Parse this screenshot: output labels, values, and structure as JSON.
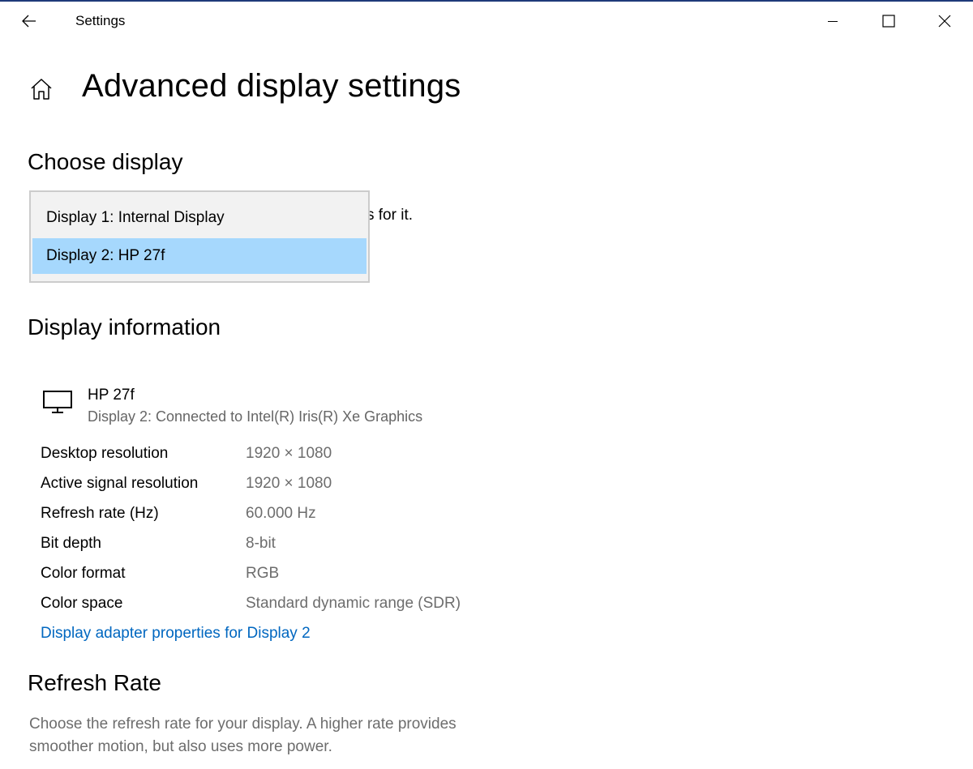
{
  "window": {
    "app_title": "Settings",
    "icons": {
      "back": "arrow-left-icon",
      "minimize": "minimize-icon",
      "maximize": "maximize-icon",
      "close": "close-icon",
      "home": "home-icon",
      "monitor": "monitor-icon"
    }
  },
  "page": {
    "title": "Advanced display settings"
  },
  "choose_display": {
    "heading": "Choose display",
    "description_visible_fragment": "s for it.",
    "options": [
      {
        "label": "Display 1: Internal Display",
        "selected": false
      },
      {
        "label": "Display 2: HP 27f",
        "selected": true
      }
    ]
  },
  "display_information": {
    "heading": "Display information",
    "monitor_name": "HP 27f",
    "monitor_subtitle": "Display 2: Connected to Intel(R) Iris(R) Xe Graphics",
    "rows": [
      {
        "label": "Desktop resolution",
        "value": "1920 × 1080"
      },
      {
        "label": "Active signal resolution",
        "value": "1920 × 1080"
      },
      {
        "label": "Refresh rate (Hz)",
        "value": "60.000 Hz"
      },
      {
        "label": "Bit depth",
        "value": "8-bit"
      },
      {
        "label": "Color format",
        "value": "RGB"
      },
      {
        "label": "Color space",
        "value": "Standard dynamic range (SDR)"
      }
    ],
    "adapter_link": "Display adapter properties for Display 2"
  },
  "refresh_rate": {
    "heading": "Refresh Rate",
    "description_line1": "Choose the refresh rate for your display. A higher rate provides",
    "description_line2": "smoother motion, but also uses more power."
  },
  "colors": {
    "accent_link": "#0067c0",
    "selected_item": "#a6d8fd",
    "secondary_text": "#6d6d6d"
  }
}
